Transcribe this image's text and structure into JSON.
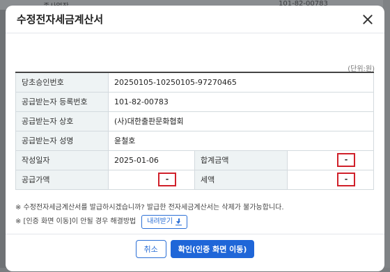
{
  "background": {
    "top_left_text": "종사업장",
    "top_right_text": "101-82-00783"
  },
  "modal": {
    "title": "수정전자세금계산서",
    "unit": "(단위:원)"
  },
  "table": {
    "rows": [
      {
        "label": "당초승인번호",
        "value": "20250105-10250105-97270465"
      },
      {
        "label": "공급받는자 등록번호",
        "value": "101-82-00783"
      },
      {
        "label": "공급받는자 상호",
        "value": "(사)대한출판문화협회"
      },
      {
        "label": "공급받는자 성명",
        "value": "윤철호"
      }
    ],
    "write_date_label": "작성일자",
    "write_date_value": "2025-01-06",
    "total_label": "합계금액",
    "total_value": "-",
    "supply_label": "공급가액",
    "supply_value": "-",
    "tax_label": "세액",
    "tax_value": "-"
  },
  "notes": {
    "line1": "※ 수정전자세금계산서를 발급하시겠습니까? 발급한 전자세금계산서는 삭제가 불가능합니다.",
    "line2": "※ [인증 화면 이동]이 안될 경우 해결방법",
    "download_label": "내려받기"
  },
  "footer": {
    "cancel_label": "취소",
    "confirm_label": "확인(인증 화면 이동)"
  }
}
